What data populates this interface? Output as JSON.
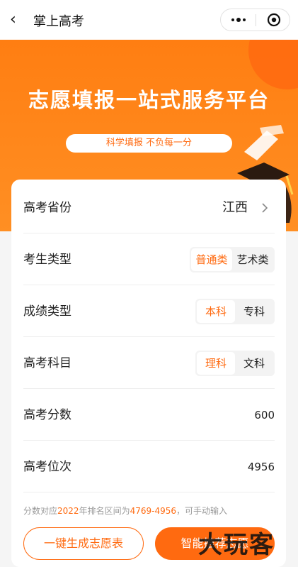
{
  "nav": {
    "back_glyph": "‹",
    "title": "掌上高考",
    "more_icon": "more-dots-icon",
    "close_icon": "target-close-icon"
  },
  "banner": {
    "headline": "志愿填报一站式服务平台",
    "slogan": "科学填报 不负每一分",
    "background_color": "#ff8a1e"
  },
  "form": {
    "province": {
      "label": "高考省份",
      "value": "江西"
    },
    "student_type": {
      "label": "考生类型",
      "options": [
        "普通类",
        "艺术类"
      ],
      "selected": "普通类"
    },
    "score_type": {
      "label": "成绩类型",
      "options": [
        "本科",
        "专科"
      ],
      "selected": "本科"
    },
    "subject": {
      "label": "高考科目",
      "options": [
        "理科",
        "文科"
      ],
      "selected": "理科"
    },
    "score": {
      "label": "高考分数",
      "value": "600"
    },
    "rank": {
      "label": "高考位次",
      "value": "4956"
    },
    "hint": {
      "prefix": "分数对应",
      "year": "2022",
      "middle": "年排名区间为",
      "range": "4769-4956",
      "suffix": "，可手动输入"
    }
  },
  "buttons": {
    "generate": "一键生成志愿表",
    "recommend": "智能推荐志愿"
  },
  "watermark": "大玩客",
  "colors": {
    "accent": "#ff6a10",
    "text": "#222222",
    "hint": "#999999"
  }
}
